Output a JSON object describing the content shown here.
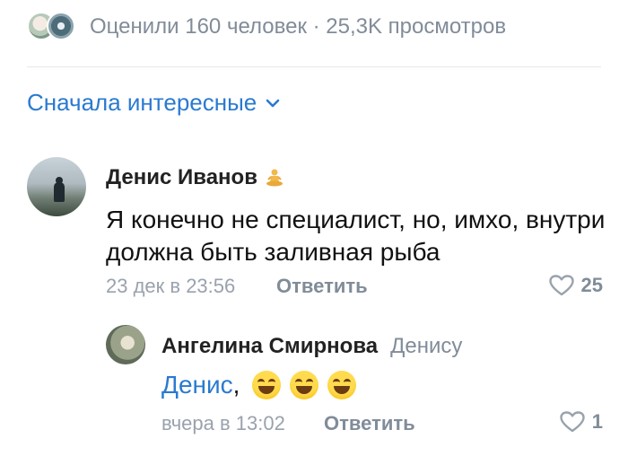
{
  "header": {
    "liked_text": "Оценили 160 человек · 25,3K просмотров"
  },
  "sort": {
    "label": "Сначала интересные"
  },
  "comments": [
    {
      "author": "Денис Иванов",
      "author_emoji": "person-in-lotus-position-icon",
      "text": "Я конечно не специалист, но, имхо, внутри должна быть заливная рыба",
      "date": "23 дек в 23:56",
      "reply_label": "Ответить",
      "likes": "25"
    },
    {
      "author": "Ангелина Смирнова",
      "reply_to": "Денису",
      "mention": "Денис",
      "text_suffix": ",",
      "emojis": [
        "laughing-face-icon",
        "laughing-face-icon",
        "laughing-face-icon"
      ],
      "date": "вчера в 13:02",
      "reply_label": "Ответить",
      "likes": "1"
    }
  ],
  "colors": {
    "accent": "#2a7ad0",
    "secondary_text": "#818c99",
    "primary_text": "#111111"
  }
}
